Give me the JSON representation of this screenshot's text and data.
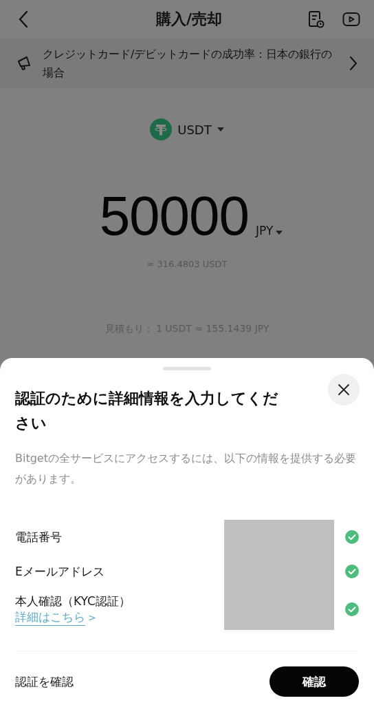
{
  "header": {
    "title": "購入/売却"
  },
  "notice": {
    "text": "クレジットカード/デビットカードの成功率：日本の銀行の場合"
  },
  "coin": {
    "symbol": "USDT"
  },
  "amount": {
    "value": "50000",
    "currency": "JPY",
    "approx": "≈ 316.4803 USDT"
  },
  "estimate": "見積もり： 1 USDT ≈ 155.1439 JPY",
  "sheet": {
    "title": "認証のために詳細情報を入力してください",
    "description": "Bitgetの全サービスにアクセスするには、以下の情報を提供する必要があります。",
    "items": [
      {
        "label": "電話番号",
        "verified": true
      },
      {
        "label": "Eメールアドレス",
        "verified": true
      },
      {
        "label": "本人確認（KYC認証）",
        "link": "詳細はこちら",
        "link_arrow": ">",
        "verified": true
      }
    ],
    "footer_label": "認証を確認",
    "confirm_button": "確認"
  }
}
